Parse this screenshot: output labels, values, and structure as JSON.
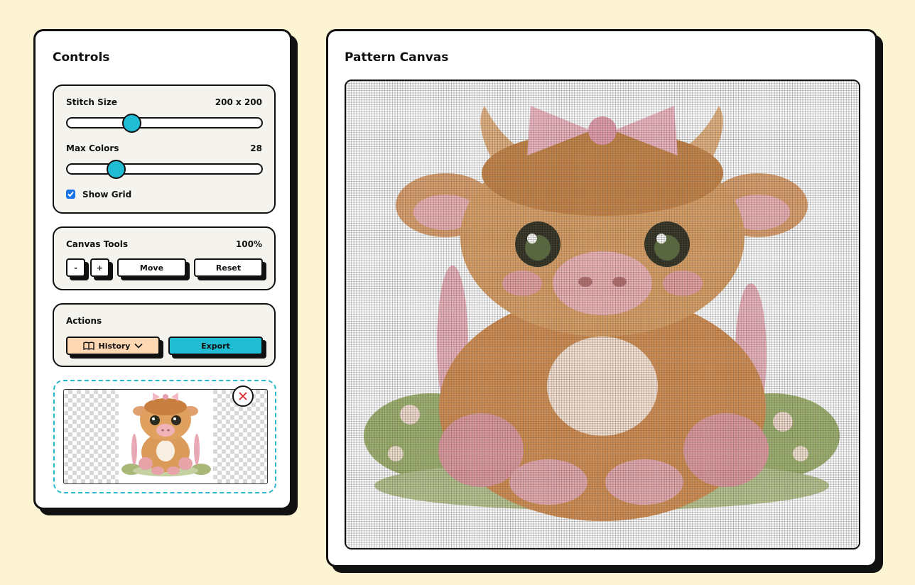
{
  "controls": {
    "title": "Controls",
    "stitch_size": {
      "label": "Stitch Size",
      "value": "200 x 200",
      "level": 0.33
    },
    "max_colors": {
      "label": "Max Colors",
      "value": "28",
      "level": 0.25
    },
    "show_grid": {
      "label": "Show Grid",
      "checked": true
    }
  },
  "canvas_tools": {
    "label": "Canvas Tools",
    "zoom": "100%",
    "zoom_out_label": "-",
    "zoom_in_label": "+",
    "move_label": "Move",
    "reset_label": "Reset"
  },
  "actions": {
    "label": "Actions",
    "history_label": "History",
    "export_label": "Export",
    "history_icon": "book-open-icon",
    "history_chevron": "chevron-down-icon"
  },
  "upload": {
    "remove_icon": "close-icon"
  },
  "canvas": {
    "title": "Pattern Canvas"
  },
  "colors": {
    "background": "#fdf4d4",
    "accent": "#20bcd4",
    "history_button": "#ffd7b3",
    "panel": "#f4f3ee",
    "remove_x": "#d9262b"
  }
}
